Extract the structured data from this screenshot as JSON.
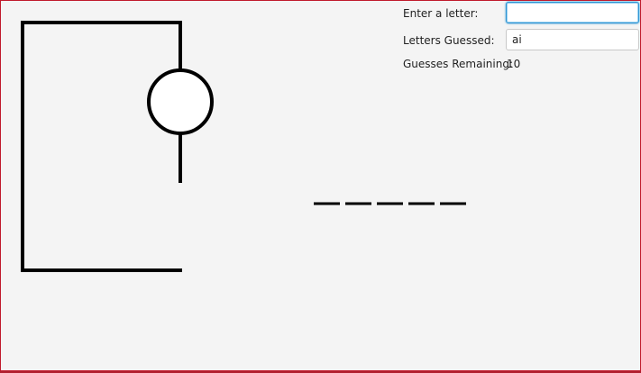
{
  "controls": {
    "enter_letter_label": "Enter a letter:",
    "letter_input_value": "",
    "letters_guessed_label": "Letters Guessed:",
    "letters_guessed_value": "ai",
    "guesses_remaining_label": "Guesses Remaining:",
    "guesses_remaining_value": "10"
  },
  "game": {
    "word_length": 5,
    "figure_parts_drawn": [
      "head",
      "body"
    ]
  },
  "colors": {
    "background": "#f4f4f4",
    "stroke": "#000000",
    "focus_border": "#2e95d4",
    "window_border": "#c01a2c"
  }
}
